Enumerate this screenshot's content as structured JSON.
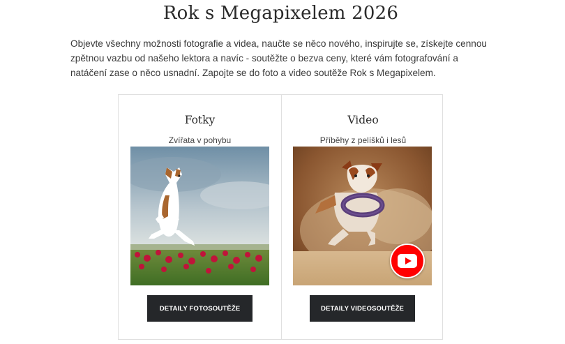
{
  "page": {
    "title": "Rok s Megapixelem 2026",
    "intro": "Objevte všechny možnosti fotografie a videa, naučte se něco nového, inspirujte se, získejte cennou zpětnou vazbu od našeho lektora a navíc - soutěžte o bezva ceny, které vám fotografování a natáčení zase o něco usnadní. Zapojte se do foto a video soutěže Rok s Megapixelem."
  },
  "cards": [
    {
      "title": "Fotky",
      "subtitle": "Zvířata v pohybu",
      "button_label": "DETAILY FOTOSOUTĚŽE",
      "image_icon": "jumping-dog-photo"
    },
    {
      "title": "Video",
      "subtitle": "Příběhy z pelíšků i lesů",
      "button_label": "DETAILY VIDEOSOUTĚŽE",
      "image_icon": "running-dog-video-thumbnail",
      "badge_icon": "youtube-play-icon"
    }
  ],
  "colors": {
    "button_bg": "#25272a",
    "button_text": "#ffffff",
    "youtube_red": "#ff0000",
    "border": "#e0e0e0"
  }
}
